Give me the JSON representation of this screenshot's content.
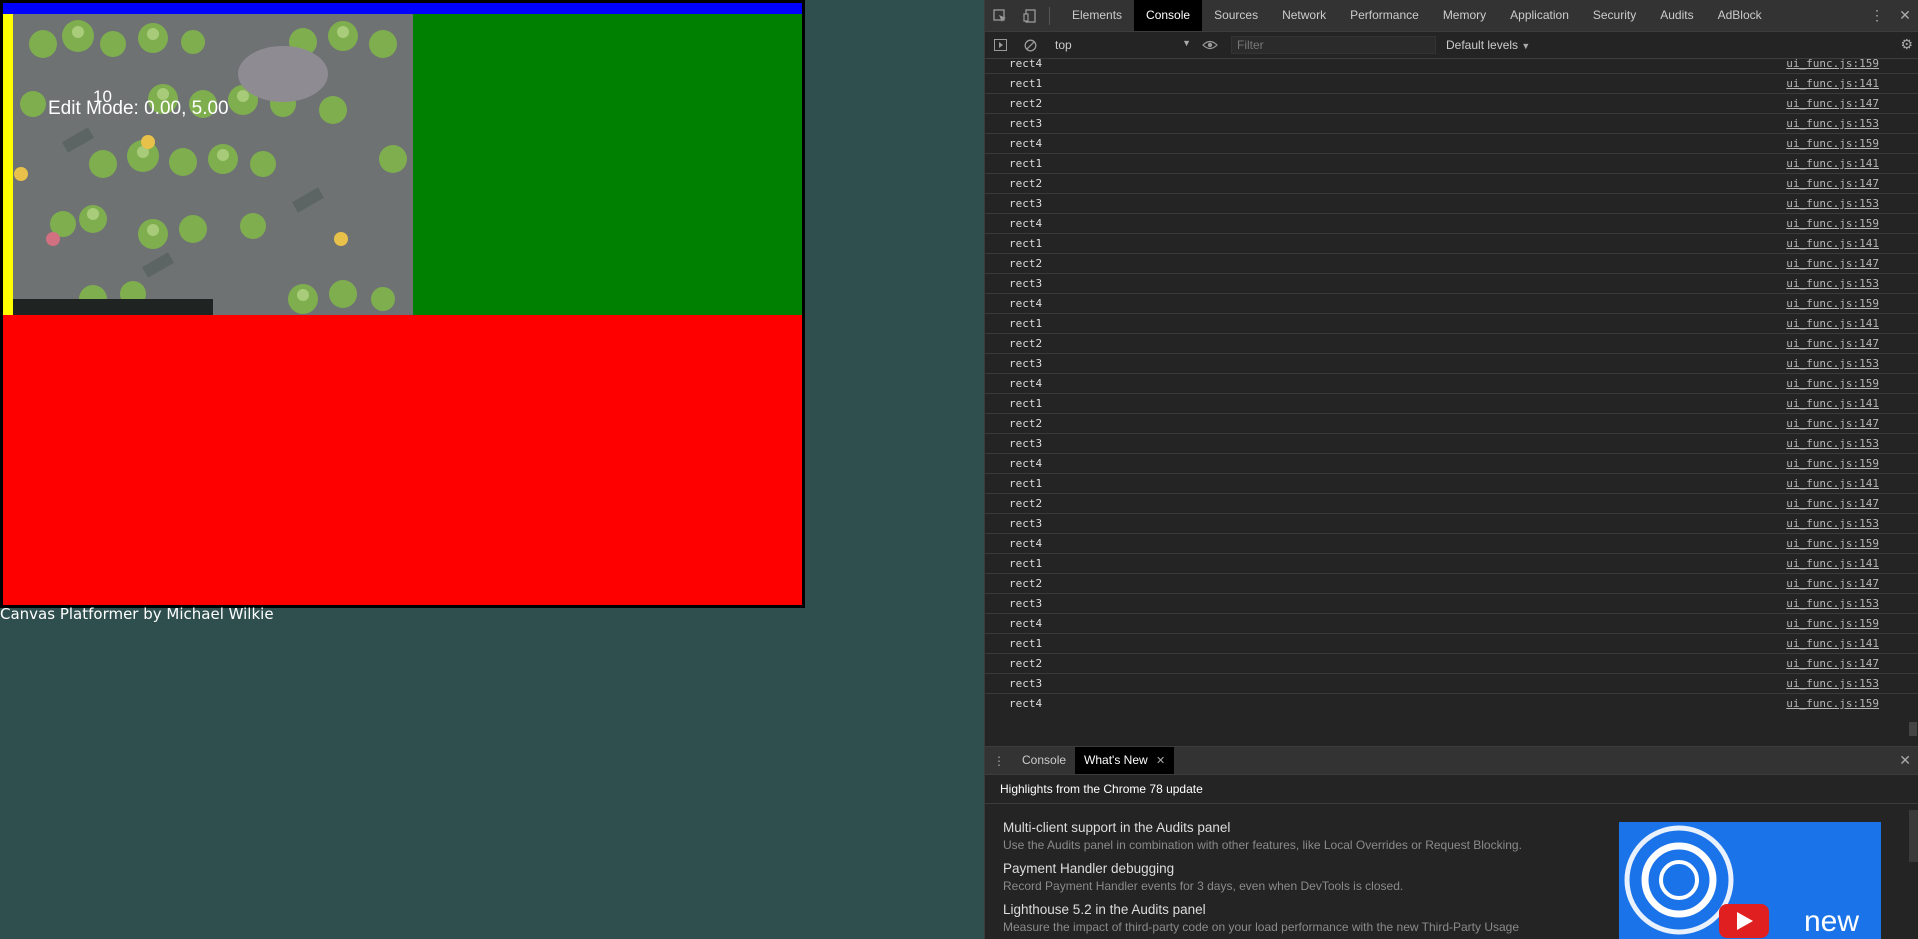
{
  "game": {
    "edit_mode_text": "Edit Mode: 0.00, 5.00",
    "counter_text": "10",
    "credit": "Canvas Platformer by Michael Wilkie",
    "colors": {
      "top_bar": "#0000ff",
      "green": "#008000",
      "red": "#ff0000",
      "yellow": "#ffff00"
    }
  },
  "devtools": {
    "tabs": [
      "Elements",
      "Console",
      "Sources",
      "Network",
      "Performance",
      "Memory",
      "Application",
      "Security",
      "Audits",
      "AdBlock"
    ],
    "active_tab": "Console",
    "toolbar": {
      "context": "top",
      "filter_placeholder": "Filter",
      "levels": "Default levels"
    },
    "log": [
      {
        "msg": "rect4",
        "src": "ui_func.js:159"
      },
      {
        "msg": "rect1",
        "src": "ui_func.js:141"
      },
      {
        "msg": "rect2",
        "src": "ui_func.js:147"
      },
      {
        "msg": "rect3",
        "src": "ui_func.js:153"
      },
      {
        "msg": "rect4",
        "src": "ui_func.js:159"
      },
      {
        "msg": "rect1",
        "src": "ui_func.js:141"
      },
      {
        "msg": "rect2",
        "src": "ui_func.js:147"
      },
      {
        "msg": "rect3",
        "src": "ui_func.js:153"
      },
      {
        "msg": "rect4",
        "src": "ui_func.js:159"
      },
      {
        "msg": "rect1",
        "src": "ui_func.js:141"
      },
      {
        "msg": "rect2",
        "src": "ui_func.js:147"
      },
      {
        "msg": "rect3",
        "src": "ui_func.js:153"
      },
      {
        "msg": "rect4",
        "src": "ui_func.js:159"
      },
      {
        "msg": "rect1",
        "src": "ui_func.js:141"
      },
      {
        "msg": "rect2",
        "src": "ui_func.js:147"
      },
      {
        "msg": "rect3",
        "src": "ui_func.js:153"
      },
      {
        "msg": "rect4",
        "src": "ui_func.js:159"
      },
      {
        "msg": "rect1",
        "src": "ui_func.js:141"
      },
      {
        "msg": "rect2",
        "src": "ui_func.js:147"
      },
      {
        "msg": "rect3",
        "src": "ui_func.js:153"
      },
      {
        "msg": "rect4",
        "src": "ui_func.js:159"
      },
      {
        "msg": "rect1",
        "src": "ui_func.js:141"
      },
      {
        "msg": "rect2",
        "src": "ui_func.js:147"
      },
      {
        "msg": "rect3",
        "src": "ui_func.js:153"
      },
      {
        "msg": "rect4",
        "src": "ui_func.js:159"
      },
      {
        "msg": "rect1",
        "src": "ui_func.js:141"
      },
      {
        "msg": "rect2",
        "src": "ui_func.js:147"
      },
      {
        "msg": "rect3",
        "src": "ui_func.js:153"
      },
      {
        "msg": "rect4",
        "src": "ui_func.js:159"
      },
      {
        "msg": "rect1",
        "src": "ui_func.js:141"
      },
      {
        "msg": "rect2",
        "src": "ui_func.js:147"
      },
      {
        "msg": "rect3",
        "src": "ui_func.js:153"
      },
      {
        "msg": "rect4",
        "src": "ui_func.js:159"
      }
    ],
    "drawer": {
      "tabs": [
        {
          "label": "Console",
          "active": false
        },
        {
          "label": "What's New",
          "active": true
        }
      ],
      "header": "Highlights from the Chrome 78 update",
      "items": [
        {
          "title": "Multi-client support in the Audits panel",
          "desc": "Use the Audits panel in combination with other features, like Local Overrides or Request Blocking."
        },
        {
          "title": "Payment Handler debugging",
          "desc": "Record Payment Handler events for 3 days, even when DevTools is closed."
        },
        {
          "title": "Lighthouse 5.2 in the Audits panel",
          "desc": "Measure the impact of third-party code on your load performance with the new Third-Party Usage"
        }
      ],
      "promo_text": "new"
    }
  }
}
